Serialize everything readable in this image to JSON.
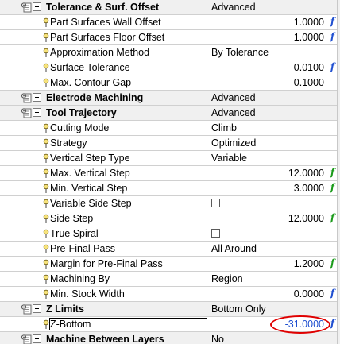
{
  "colors": {
    "fx_blue": "#1f4fd0",
    "fx_green": "#1a9a1a",
    "highlight": "#e00000"
  },
  "rows": [
    {
      "type": "section",
      "expanded": true,
      "label": "Tolerance & Surf. Offset",
      "value": "Advanced",
      "name": "tolerance-surf-offset"
    },
    {
      "type": "param",
      "label": "Part Surfaces Wall Offset",
      "num": "1.0000",
      "fx": "blue",
      "name": "part-surfaces-wall-offset"
    },
    {
      "type": "param",
      "label": "Part Surfaces Floor Offset",
      "num": "1.0000",
      "fx": "blue",
      "name": "part-surfaces-floor-offset"
    },
    {
      "type": "param",
      "label": "Approximation Method",
      "value": "By Tolerance",
      "name": "approximation-method"
    },
    {
      "type": "param",
      "label": "Surface Tolerance",
      "num": "0.0100",
      "fx": "blue",
      "name": "surface-tolerance"
    },
    {
      "type": "param",
      "label": "Max. Contour Gap",
      "num": "0.1000",
      "name": "max-contour-gap"
    },
    {
      "type": "section",
      "expanded": false,
      "label": "Electrode Machining",
      "value": "Advanced",
      "name": "electrode-machining"
    },
    {
      "type": "section",
      "expanded": true,
      "label": "Tool Trajectory",
      "value": "Advanced",
      "name": "tool-trajectory"
    },
    {
      "type": "param",
      "label": "Cutting Mode",
      "value": "Climb",
      "name": "cutting-mode"
    },
    {
      "type": "param",
      "label": "Strategy",
      "value": "Optimized",
      "name": "strategy"
    },
    {
      "type": "param",
      "label": "Vertical Step Type",
      "value": "Variable",
      "name": "vertical-step-type"
    },
    {
      "type": "param",
      "label": "Max. Vertical Step",
      "num": "12.0000",
      "fx": "green",
      "name": "max-vertical-step"
    },
    {
      "type": "param",
      "label": "Min. Vertical Step",
      "num": "3.0000",
      "fx": "green",
      "name": "min-vertical-step"
    },
    {
      "type": "param",
      "label": "Variable Side Step",
      "checkbox": true,
      "checked": false,
      "name": "variable-side-step"
    },
    {
      "type": "param",
      "label": "Side Step",
      "num": "12.0000",
      "fx": "green",
      "name": "side-step"
    },
    {
      "type": "param",
      "label": "True Spiral",
      "checkbox": true,
      "checked": false,
      "name": "true-spiral"
    },
    {
      "type": "param",
      "label": "Pre-Final Pass",
      "value": "All Around",
      "name": "pre-final-pass"
    },
    {
      "type": "param",
      "label": "Margin for Pre-Final Pass",
      "num": "1.2000",
      "fx": "green",
      "name": "margin-for-pre-final-pass"
    },
    {
      "type": "param",
      "label": "Machining By",
      "value": "Region",
      "name": "machining-by"
    },
    {
      "type": "param",
      "label": "Min. Stock Width",
      "num": "0.0000",
      "fx": "blue",
      "name": "min-stock-width"
    },
    {
      "type": "section",
      "expanded": true,
      "label": "Z Limits",
      "value": "Bottom Only",
      "name": "z-limits"
    },
    {
      "type": "param",
      "label": "Z-Bottom",
      "num": "-31.0000",
      "fx": "blue",
      "selected": true,
      "name": "z-bottom"
    },
    {
      "type": "section",
      "expanded": false,
      "label": "Machine Between Layers",
      "value": "No",
      "name": "machine-between-layers"
    }
  ]
}
